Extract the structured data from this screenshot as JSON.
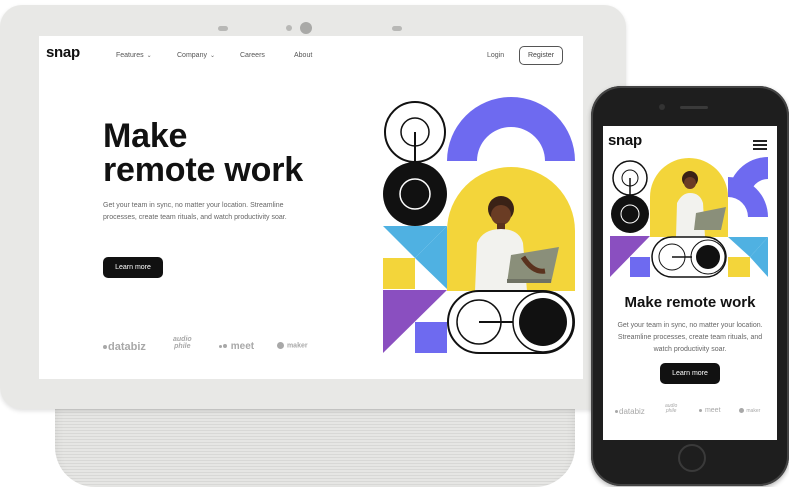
{
  "colors": {
    "purple": "#6e6af0",
    "yellow": "#f3d53a",
    "blue": "#4fb1e2",
    "violet": "#8a4fc0",
    "black": "#111111",
    "device_frame": "#e8e8e6"
  },
  "desktop": {
    "logo": "snap",
    "nav": {
      "features": "Features",
      "company": "Company",
      "careers": "Careers",
      "about": "About",
      "chevron": "⌄",
      "login": "Login",
      "register": "Register"
    },
    "hero": {
      "title_line1": "Make",
      "title_line2": "remote work",
      "subtitle": "Get your team in sync, no matter your location. Streamline processes, create team rituals, and watch productivity soar.",
      "cta": "Learn more"
    },
    "clients": {
      "databiz": "databiz",
      "audiophile_1": "audio",
      "audiophile_2": "phile",
      "meet": "meet",
      "maker": "maker"
    }
  },
  "mobile": {
    "logo": "snap",
    "menu_icon": "hamburger-icon",
    "hero": {
      "title": "Make remote work",
      "subtitle": "Get your team in sync, no matter your location. Streamline processes, create team rituals, and watch productivity soar.",
      "cta": "Learn more"
    },
    "clients": {
      "databiz": "databiz",
      "audiophile_1": "audio",
      "audiophile_2": "phile",
      "meet": "meet",
      "maker": "maker"
    }
  }
}
